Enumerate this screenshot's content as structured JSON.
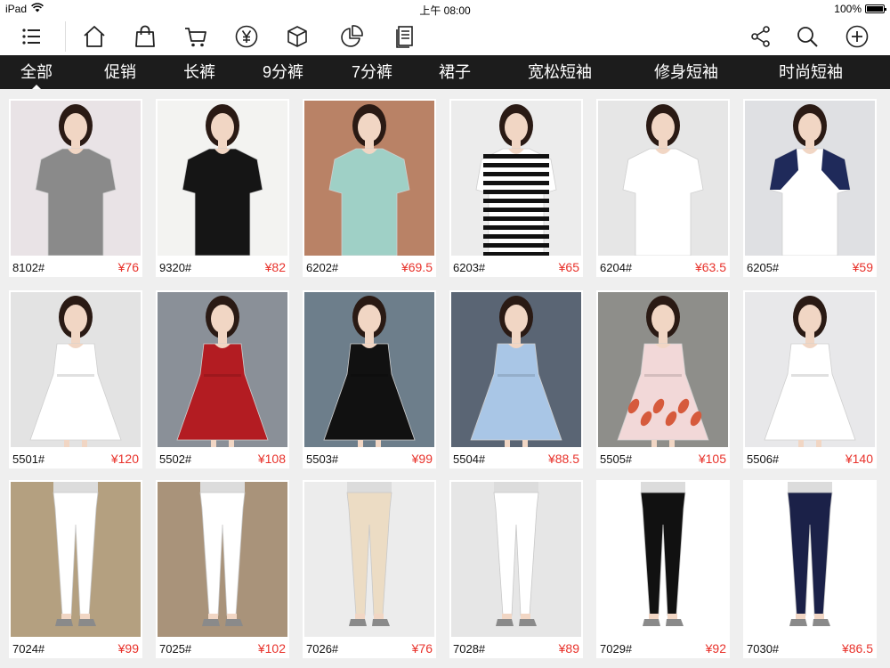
{
  "status_bar": {
    "device": "iPad",
    "time": "上午 08:00",
    "battery": "100%"
  },
  "toolbar": {
    "left_icons": [
      "list-icon",
      "home-icon",
      "bag-icon",
      "cart-icon",
      "yen-icon",
      "box-icon",
      "pie-chart-icon",
      "document-icon"
    ],
    "right_icons": [
      "share-icon",
      "search-icon",
      "add-icon"
    ]
  },
  "categories": [
    {
      "label": "全部",
      "active": true
    },
    {
      "label": "促销"
    },
    {
      "label": "长裤"
    },
    {
      "label": "9分裤"
    },
    {
      "label": "7分裤"
    },
    {
      "label": "裙子"
    },
    {
      "label": "宽松短袖"
    },
    {
      "label": "修身短袖"
    },
    {
      "label": "时尚短袖"
    }
  ],
  "products": [
    {
      "code": "8102#",
      "price": "¥76",
      "bg": "#e9e3e6",
      "item": "shirt",
      "color": "#8a8a8a",
      "trim": "",
      "stripes": false
    },
    {
      "code": "9320#",
      "price": "¥82",
      "bg": "#f3f3f1",
      "item": "shirt",
      "color": "#151515",
      "trim": "",
      "stripes": false
    },
    {
      "code": "6202#",
      "price": "¥69.5",
      "bg": "#b98266",
      "item": "shirt",
      "color": "#9fd0c6",
      "trim": "",
      "stripes": false
    },
    {
      "code": "6203#",
      "price": "¥65",
      "bg": "#ececec",
      "item": "shirt",
      "color": "#ffffff",
      "trim": "",
      "stripes": true
    },
    {
      "code": "6204#",
      "price": "¥63.5",
      "bg": "#e6e6e6",
      "item": "shirt",
      "color": "#ffffff",
      "trim": "",
      "stripes": false
    },
    {
      "code": "6205#",
      "price": "¥59",
      "bg": "#dfe0e3",
      "item": "shirt",
      "color": "#ffffff",
      "trim": "#1f2a5a",
      "stripes": false
    },
    {
      "code": "5501#",
      "price": "¥120",
      "bg": "#e3e3e3",
      "item": "dress",
      "color": "#ffffff",
      "trim": "",
      "stripes": false
    },
    {
      "code": "5502#",
      "price": "¥108",
      "bg": "#8a9098",
      "item": "dress",
      "color": "#b31c22",
      "trim": "",
      "stripes": false
    },
    {
      "code": "5503#",
      "price": "¥99",
      "bg": "#6d7e8b",
      "item": "dress",
      "color": "#111111",
      "trim": "",
      "stripes": false
    },
    {
      "code": "5504#",
      "price": "¥88.5",
      "bg": "#5a6574",
      "item": "dress",
      "color": "#a9c6e6",
      "trim": "",
      "stripes": false
    },
    {
      "code": "5505#",
      "price": "¥105",
      "bg": "#8e8e8a",
      "item": "dress",
      "color": "#f2d8d8",
      "trim": "#d65a3c",
      "stripes": false
    },
    {
      "code": "5506#",
      "price": "¥140",
      "bg": "#e8e8ea",
      "item": "dress",
      "color": "#ffffff",
      "trim": "",
      "stripes": false
    },
    {
      "code": "7024#",
      "price": "¥99",
      "bg": "#b4a080",
      "item": "pants",
      "color": "#ffffff",
      "trim": "",
      "stripes": false
    },
    {
      "code": "7025#",
      "price": "¥102",
      "bg": "#a9937a",
      "item": "pants",
      "color": "#ffffff",
      "trim": "",
      "stripes": false
    },
    {
      "code": "7026#",
      "price": "¥76",
      "bg": "#ececec",
      "item": "pants",
      "color": "#ecdcc4",
      "trim": "",
      "stripes": false
    },
    {
      "code": "7028#",
      "price": "¥89",
      "bg": "#e6e6e6",
      "item": "pants",
      "color": "#ffffff",
      "trim": "",
      "stripes": false
    },
    {
      "code": "7029#",
      "price": "¥92",
      "bg": "#ffffff",
      "item": "pants",
      "color": "#111111",
      "trim": "",
      "stripes": false
    },
    {
      "code": "7030#",
      "price": "¥86.5",
      "bg": "#ffffff",
      "item": "pants",
      "color": "#1b2148",
      "trim": "",
      "stripes": false
    }
  ]
}
